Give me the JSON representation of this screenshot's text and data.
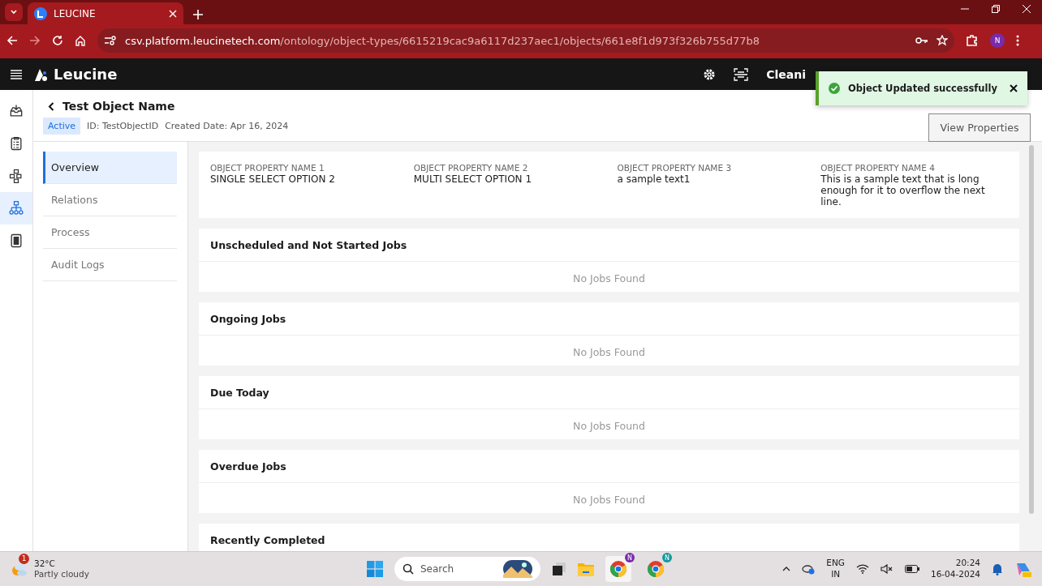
{
  "browser": {
    "tab_title": "LEUCINE",
    "url_host": "csv.platform.leucinetech.com",
    "url_path": "/ontology/object-types/6615219cac9a6117d237aec1/objects/661e8f1d973f326b755d77b8",
    "profile_initial": "N"
  },
  "app_header": {
    "brand": "Leucine",
    "nav_text": "Cleani"
  },
  "toast": {
    "message": "Object Updated successfully"
  },
  "rail": [
    {
      "kind": "inbox",
      "selected": false
    },
    {
      "kind": "checklist",
      "selected": false
    },
    {
      "kind": "flow",
      "selected": false
    },
    {
      "kind": "hierarchy",
      "selected": true
    },
    {
      "kind": "report",
      "selected": false
    }
  ],
  "object": {
    "title": "Test Object Name",
    "status": "Active",
    "id": "ID: TestObjectID",
    "created": "Created Date: Apr 16, 2024",
    "button": "View Properties"
  },
  "subnav": [
    {
      "label": "Overview",
      "selected": true
    },
    {
      "label": "Relations",
      "selected": false
    },
    {
      "label": "Process",
      "selected": false
    },
    {
      "label": "Audit Logs",
      "selected": false
    }
  ],
  "properties": [
    {
      "name": "OBJECT PROPERTY NAME 1",
      "value": "SINGLE SELECT OPTION 2"
    },
    {
      "name": "OBJECT PROPERTY NAME 2",
      "value": "MULTI SELECT OPTION 1"
    },
    {
      "name": "OBJECT PROPERTY NAME 3",
      "value": "a sample text1"
    },
    {
      "name": "OBJECT PROPERTY NAME 4",
      "value": "This is a sample text that is long enough for it to overflow the next line."
    }
  ],
  "job_sections": [
    {
      "title": "Unscheduled and Not Started Jobs",
      "empty": "No Jobs Found"
    },
    {
      "title": "Ongoing Jobs",
      "empty": "No Jobs Found"
    },
    {
      "title": "Due Today",
      "empty": "No Jobs Found"
    },
    {
      "title": "Overdue Jobs",
      "empty": "No Jobs Found"
    },
    {
      "title": "Recently Completed"
    }
  ],
  "taskbar": {
    "weather_badge": "1",
    "temperature": "32°C",
    "weather": "Partly cloudy",
    "search": "Search",
    "lang": "ENG",
    "region": "IN",
    "time": "20:24",
    "date": "16-04-2024",
    "chrome_badges": [
      "N",
      "N"
    ]
  }
}
